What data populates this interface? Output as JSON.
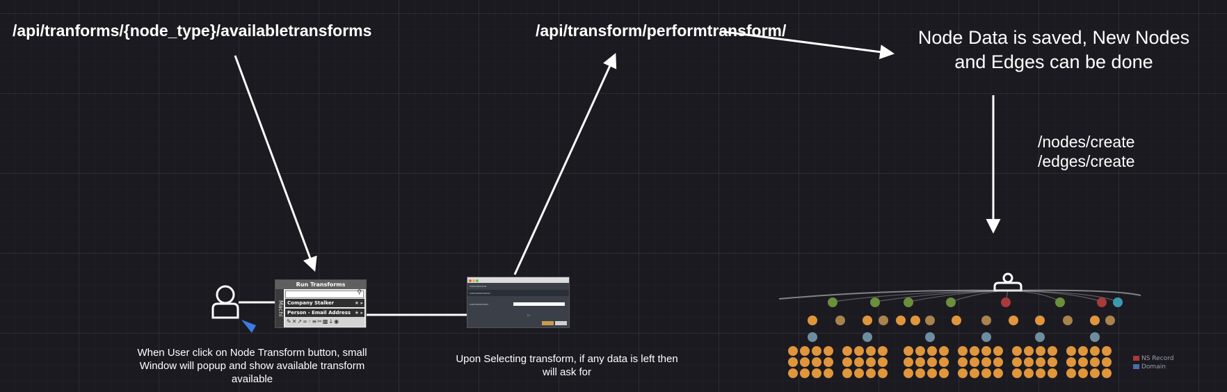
{
  "labels": {
    "available_transforms_api": "/api/tranforms/{node_type}/availabletransforms",
    "perform_transform_api": "/api/transform/performtransform/",
    "node_data_saved": "Node Data is saved, New Nodes and Edges can be done",
    "nodes_create": "/nodes/create",
    "edges_create": "/edges/create",
    "caption_popup": "When User click on Node Transform button, small Window will popup and show available transform available",
    "caption_required": "Upon Selecting transform, if any data is left then will ask for"
  },
  "run_transforms_window": {
    "title": "Run Transforms",
    "side_tab": "Machi",
    "rows": [
      "Company Stalker",
      "Person - Email Address"
    ]
  },
  "legend": {
    "items": [
      {
        "label": "NS Record",
        "color": "#a83a3a"
      },
      {
        "label": "Domain",
        "color": "#4a6ea8"
      }
    ]
  },
  "node_colors": {
    "green": "#6b8f3a",
    "red": "#a83a3a",
    "teal": "#3a9bb0",
    "orange": "#e0963c",
    "tan": "#a8834d",
    "steel": "#6e8ea0",
    "arrow": "#ffffff"
  }
}
